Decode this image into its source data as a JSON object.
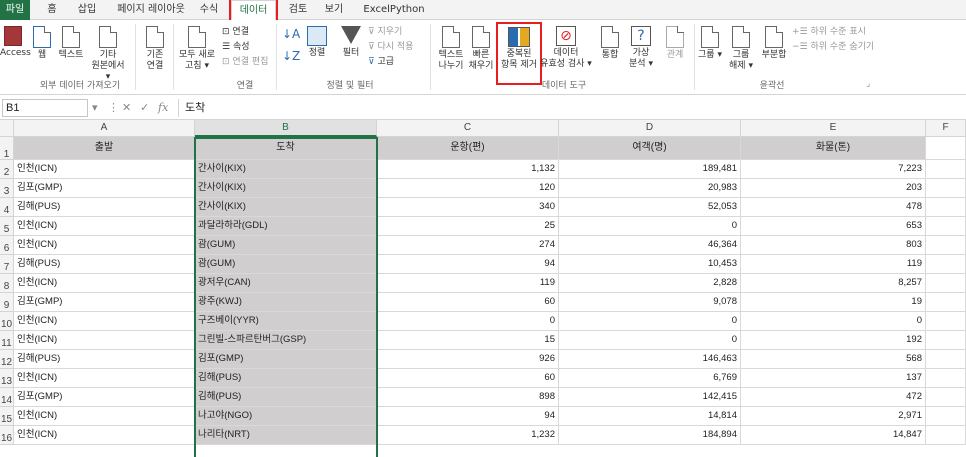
{
  "tabs": [
    "파일",
    "홈",
    "삽입",
    "페이지 레이아웃",
    "수식",
    "데이터",
    "검토",
    "보기",
    "ExcelPython"
  ],
  "ribbon": {
    "get_external": {
      "access": "Access",
      "web": "웹",
      "text": "텍스트",
      "other_1": "기타",
      "other_2": "원본에서",
      "group": "외부 데이터 가져오기"
    },
    "existing_1": "기존",
    "existing_2": "연결",
    "connections": {
      "refresh_1": "모두 새로",
      "refresh_2": "고침",
      "connections": "연결",
      "properties": "속성",
      "edit_links": "연결 편집",
      "group": "연결"
    },
    "sort_filter": {
      "sort": "정렬",
      "filter": "필터",
      "clear": "지우기",
      "reapply": "다시 적용",
      "advanced": "고급",
      "group": "정렬 및 필터"
    },
    "data_tools": {
      "text_to_cols_1": "텍스트",
      "text_to_cols_2": "나누기",
      "flash_fill_1": "빠른",
      "flash_fill_2": "채우기",
      "remove_dup_1": "중복된",
      "remove_dup_2": "항목 제거",
      "validation_1": "데이터",
      "validation_2": "유효성 검사",
      "consolidate": "통합",
      "whatif_1": "가상",
      "whatif_2": "분석",
      "relations": "관계",
      "group": "데이터 도구"
    },
    "outline": {
      "group_btn": "그룹",
      "ungroup_1": "그룹",
      "ungroup_2": "해제",
      "subtotal": "부분합",
      "show_detail": "하위 수준 표시",
      "hide_detail": "하위 수준 숨기기",
      "group": "윤곽선"
    }
  },
  "formula_bar": {
    "name_box": "B1",
    "fx": "fx",
    "value": "도착"
  },
  "columns": [
    "A",
    "B",
    "C",
    "D",
    "E",
    "F"
  ],
  "headers": [
    "출발",
    "도착",
    "운항(편)",
    "여객(명)",
    "화물(톤)"
  ],
  "rows": [
    [
      "인천(ICN)",
      "간사이(KIX)",
      "1,132",
      "189,481",
      "7,223"
    ],
    [
      "김포(GMP)",
      "간사이(KIX)",
      "120",
      "20,983",
      "203"
    ],
    [
      "김해(PUS)",
      "간사이(KIX)",
      "340",
      "52,053",
      "478"
    ],
    [
      "인천(ICN)",
      "과달라하라(GDL)",
      "25",
      "0",
      "653"
    ],
    [
      "인천(ICN)",
      "괌(GUM)",
      "274",
      "46,364",
      "803"
    ],
    [
      "김해(PUS)",
      "괌(GUM)",
      "94",
      "10,453",
      "119"
    ],
    [
      "인천(ICN)",
      "광저우(CAN)",
      "119",
      "2,828",
      "8,257"
    ],
    [
      "김포(GMP)",
      "광주(KWJ)",
      "60",
      "9,078",
      "19"
    ],
    [
      "인천(ICN)",
      "구즈베이(YYR)",
      "0",
      "0",
      "0"
    ],
    [
      "인천(ICN)",
      "그린빌-스파르탄버그(GSP)",
      "15",
      "0",
      "192"
    ],
    [
      "김해(PUS)",
      "김포(GMP)",
      "926",
      "146,463",
      "568"
    ],
    [
      "인천(ICN)",
      "김해(PUS)",
      "60",
      "6,769",
      "137"
    ],
    [
      "김포(GMP)",
      "김해(PUS)",
      "898",
      "142,415",
      "472"
    ],
    [
      "인천(ICN)",
      "나고야(NGO)",
      "94",
      "14,814",
      "2,971"
    ],
    [
      "인천(ICN)",
      "나리타(NRT)",
      "1,232",
      "184,894",
      "14,847"
    ]
  ],
  "row_numbers": [
    "1",
    "2",
    "3",
    "4",
    "5",
    "6",
    "7",
    "8",
    "9",
    "10",
    "11",
    "12",
    "13",
    "14",
    "15",
    "16"
  ],
  "colors": {
    "accent": "#217346",
    "highlight": "#e81e1e",
    "header_fill": "#d0cece"
  }
}
